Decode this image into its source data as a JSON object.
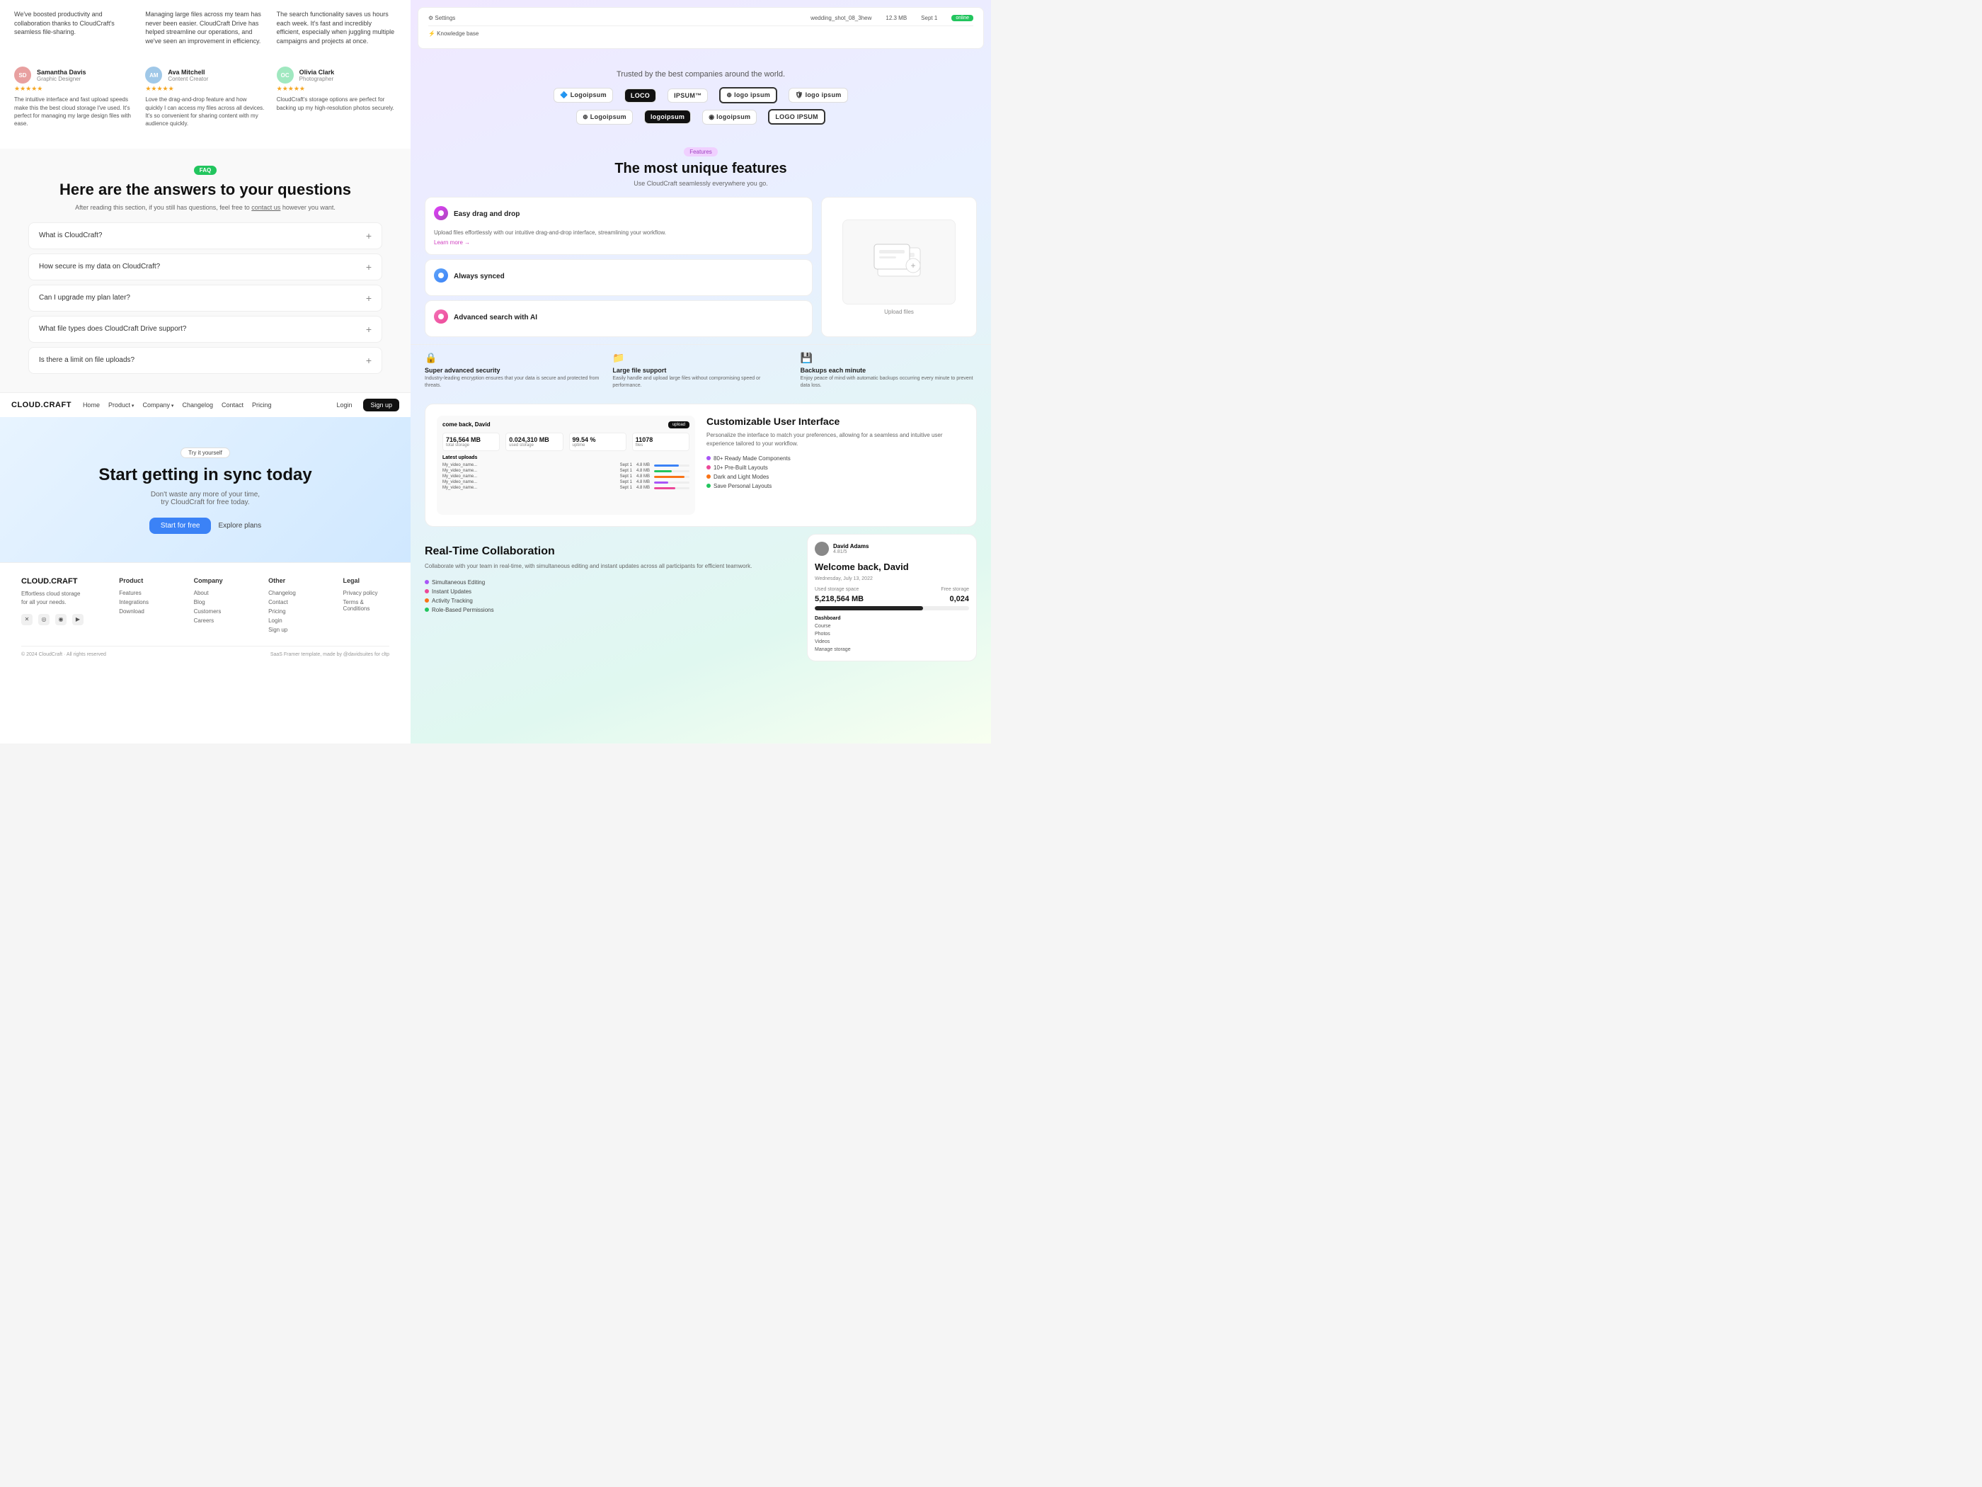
{
  "left": {
    "testimonials": [
      {
        "reviewer": "Samantha Davis",
        "role": "Graphic Designer",
        "avatar_text": "SD",
        "avatar_color": "#e8a0a0",
        "stars": "★★★★★",
        "text": "The intuitive interface and fast upload speeds make this the best cloud storage I've used. It's perfect for managing my large design files with ease."
      },
      {
        "reviewer": "Ava Mitchell",
        "role": "Content Creator",
        "avatar_text": "AM",
        "avatar_color": "#a0c8e8",
        "stars": "★★★★★",
        "text": "Love the drag-and-drop feature and how quickly I can access my files across all devices. It's so convenient for sharing content with my audience quickly."
      },
      {
        "reviewer": "Olivia Clark",
        "role": "Photographer",
        "avatar_text": "OC",
        "avatar_color": "#a0e8c0",
        "stars": "★★★★★",
        "text": "CloudCraft's storage options are perfect for backing up my high-resolution photos securely."
      }
    ],
    "top_text": [
      "We've boosted productivity and collaboration thanks to CloudCraft's seamless file-sharing.",
      "Managing large files across my team has never been easier. CloudCraft Drive has helped streamline our operations, and we've seen an improvement in efficiency.",
      "The search functionality saves us hours each week. It's fast and incredibly efficient, especially when juggling multiple campaigns and projects at once."
    ],
    "faq": {
      "badge": "FAQ",
      "title": "Here are the answers to your questions",
      "subtitle": "After reading this section, if you still has questions, feel free to contact us however you want.",
      "contact_link": "contact us",
      "items": [
        {
          "question": "What is CloudCraft?"
        },
        {
          "question": "How secure is my data on CloudCraft?"
        },
        {
          "question": "Can I upgrade my plan later?"
        },
        {
          "question": "What file types does CloudCraft Drive support?"
        },
        {
          "question": "Is there a limit on file uploads?"
        }
      ]
    },
    "nav": {
      "logo": "CLOUD.CRAFT",
      "links": [
        "Home",
        "Product",
        "Company",
        "Changelog",
        "Contact",
        "Pricing"
      ],
      "login": "Login",
      "cta": "Sign up"
    },
    "cta": {
      "badge": "Try it yourself",
      "title": "Start getting in sync today",
      "subtitle": "Don't waste any more of your time,\ntry CloudCraft for free today.",
      "btn_primary": "Start for free",
      "btn_secondary": "Explore plans"
    },
    "footer": {
      "logo": "CLOUD.CRAFT",
      "brand_text": "Effortless cloud storage\nfor all your needs.",
      "columns": [
        {
          "title": "Product",
          "links": [
            "Features",
            "Integrations",
            "Download"
          ]
        },
        {
          "title": "Company",
          "links": [
            "About",
            "Blog",
            "Customers",
            "Careers"
          ]
        },
        {
          "title": "Other",
          "links": [
            "Changelog",
            "Contact",
            "Pricing",
            "Login",
            "Sign up"
          ]
        },
        {
          "title": "Legal",
          "links": [
            "Privacy policy",
            "Terms & Conditions"
          ]
        }
      ],
      "copyright": "© 2024 CloudCraft · All rights reserved",
      "made_by": "SaaS Framer template, made by @davidsuites for cltp"
    }
  },
  "right": {
    "file_manager": {
      "settings": "⚙ Settings",
      "kb": "12.3 MB",
      "date": "Sept 1",
      "badge": "online",
      "kb_link": "⚡ Knowledge base",
      "filename": "wedding_shot_08_3hew"
    },
    "trusted": {
      "title": "Trusted by the best companies around the world.",
      "logos": [
        "Logoipsum",
        "LOCO",
        "IPSUM",
        "logo ipsum",
        "logo ipsum",
        "Logoipsum",
        "logoipsum",
        "logoipsum",
        "LOGO IPSUM"
      ]
    },
    "features": {
      "badge": "Features",
      "title": "The most unique features",
      "subtitle": "Use CloudCraft seamlessly everywhere you go.",
      "items": [
        {
          "name": "Easy drag and drop",
          "desc": "Upload files effortlessly with our intuitive drag-and-drop interface, streamlining your workflow.",
          "link": "Learn more →"
        },
        {
          "name": "Always synced",
          "desc": ""
        },
        {
          "name": "Advanced search with AI",
          "desc": ""
        }
      ],
      "preview_label": "Upload files"
    },
    "bottom_features": [
      {
        "icon": "🔒",
        "title": "Super advanced security",
        "desc": "Industry-leading encryption ensures that your data is secure and protected from threats."
      },
      {
        "icon": "📁",
        "title": "Large file support",
        "desc": "Easily handle and upload large files without compromising speed or performance."
      },
      {
        "icon": "💾",
        "title": "Backups each minute",
        "desc": "Enjoy peace of mind with automatic backups occurring every minute to prevent data loss."
      }
    ],
    "custom_ui": {
      "title": "Customizable User Interface",
      "desc": "Personalize the interface to match your preferences, allowing for a seamless and intuitive user experience tailored to your workflow.",
      "features": [
        {
          "text": "80+ Ready Made Components",
          "color": "#a855f7"
        },
        {
          "text": "10+ Pre-Built Layouts",
          "color": "#ec4899"
        },
        {
          "text": "Dark and Light Modes",
          "color": "#f97316"
        },
        {
          "text": "Save Personal Layouts",
          "color": "#22c55e"
        }
      ],
      "dashboard": {
        "greeting": "come back, David",
        "btn": "upload",
        "stats": [
          {
            "val": "716,564 MB",
            "lbl": "total storage"
          },
          {
            "val": "0.024,310 MB",
            "lbl": "used storage"
          },
          {
            "val": "99.54 %",
            "lbl": "uptime"
          },
          {
            "val": "11078",
            "lbl": "files"
          }
        ],
        "uploads_title": "Latest uploads",
        "upload_rows": [
          {
            "name": "My_video_name...",
            "date": "Sept 1",
            "size": "4.8 MB",
            "bar_pct": 70,
            "bar_color": "#3b82f6"
          },
          {
            "name": "My_video_name...",
            "date": "Sept 1",
            "size": "4.8 MB",
            "bar_pct": 50,
            "bar_color": "#22c55e"
          },
          {
            "name": "My_video_name...",
            "date": "Sept 1",
            "size": "4.8 MB",
            "bar_pct": 85,
            "bar_color": "#f97316"
          },
          {
            "name": "My_video_name...",
            "date": "Sept 1",
            "size": "4.8 MB",
            "bar_pct": 40,
            "bar_color": "#a855f7"
          },
          {
            "name": "My_video_name...",
            "date": "Sept 1",
            "size": "4.8 MB",
            "bar_pct": 60,
            "bar_color": "#ec4899"
          }
        ]
      }
    },
    "realtime_collab": {
      "title": "Real-Time Collaboration",
      "desc": "Collaborate with your team in real-time, with simultaneous editing and instant updates across all participants for efficient teamwork.",
      "features": [
        {
          "text": "Simultaneous Editing",
          "color": "#a855f7"
        },
        {
          "text": "Instant Updates",
          "color": "#ec4899"
        },
        {
          "text": "Activity Tracking",
          "color": "#f97316"
        },
        {
          "text": "Role-Based Permissions",
          "color": "#22c55e"
        }
      ],
      "preview": {
        "user": "David Adams",
        "avatar_color": "#888",
        "rating": "4.81/5",
        "greeting": "Welcome back, David",
        "date": "Wednesday, July 13, 2022",
        "used_label": "Used storage space",
        "free_label": "Free storage",
        "used_val": "5,218,564 MB",
        "free_val": "0,024",
        "nav_items": [
          "Dashboard",
          "Course",
          "Photos",
          "Videos",
          "Manage storage"
        ]
      }
    }
  }
}
